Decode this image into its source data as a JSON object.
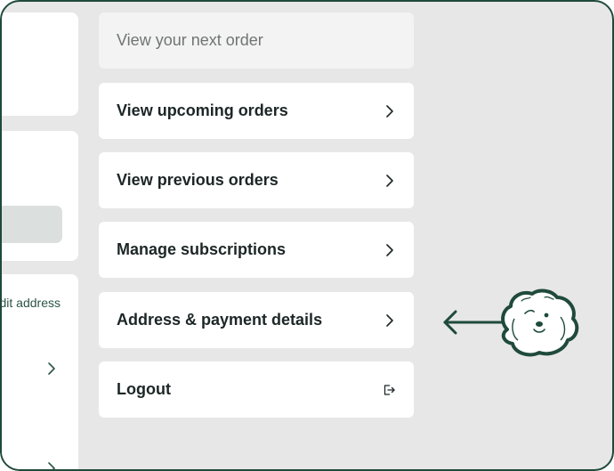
{
  "left_panel": {
    "edit_address_link": "Edit address"
  },
  "menu": {
    "items": [
      {
        "label": "View your next order",
        "icon": "none",
        "muted": true
      },
      {
        "label": "View upcoming orders",
        "icon": "chevron-right-icon"
      },
      {
        "label": "View previous orders",
        "icon": "chevron-right-icon"
      },
      {
        "label": "Manage subscriptions",
        "icon": "chevron-right-icon"
      },
      {
        "label": "Address & payment details",
        "icon": "chevron-right-icon"
      },
      {
        "label": "Logout",
        "icon": "logout-icon"
      }
    ]
  },
  "decoration": {
    "pointer": "arrow-left-icon",
    "mascot": "dog-mascot-icon",
    "accent_color": "#1f4a3c"
  }
}
